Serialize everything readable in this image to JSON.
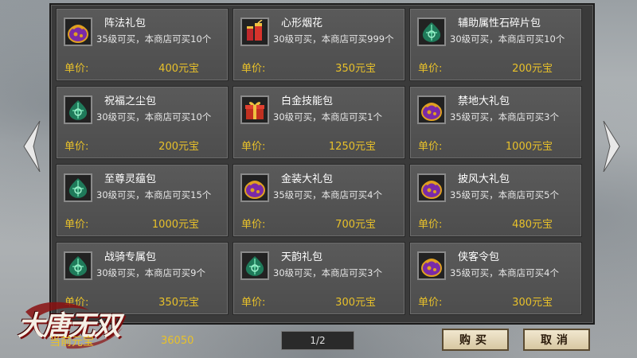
{
  "game": {
    "logo_text": "大唐无双"
  },
  "shop": {
    "price_label": "单价:",
    "items": [
      {
        "name": "阵法礼包",
        "desc": "35级可买，本商店可买10个",
        "price": "400元宝",
        "icon": "purple-gift-bag-icon"
      },
      {
        "name": "心形烟花",
        "desc": "30级可买，本商店可买999个",
        "price": "350元宝",
        "icon": "firework-icon"
      },
      {
        "name": "辅助属性石碎片包",
        "desc": "30级可买，本商店可买10个",
        "price": "200元宝",
        "icon": "green-bag-icon"
      },
      {
        "name": "祝福之尘包",
        "desc": "30级可买，本商店可买10个",
        "price": "200元宝",
        "icon": "green-bag-icon"
      },
      {
        "name": "白金技能包",
        "desc": "30级可买，本商店可买1个",
        "price": "1250元宝",
        "icon": "gift-box-icon"
      },
      {
        "name": "禁地大礼包",
        "desc": "35级可买，本商店可买3个",
        "price": "1000元宝",
        "icon": "purple-gift-bag-icon"
      },
      {
        "name": "至尊灵蕴包",
        "desc": "30级可买，本商店可买15个",
        "price": "1000元宝",
        "icon": "green-bag-icon"
      },
      {
        "name": "金装大礼包",
        "desc": "35级可买，本商店可买4个",
        "price": "700元宝",
        "icon": "purple-gift-bag-icon"
      },
      {
        "name": "披风大礼包",
        "desc": "35级可买，本商店可买5个",
        "price": "480元宝",
        "icon": "purple-gift-bag-icon"
      },
      {
        "name": "战骑专属包",
        "desc": "30级可买，本商店可买9个",
        "price": "350元宝",
        "icon": "green-bag-icon"
      },
      {
        "name": "天韵礼包",
        "desc": "30级可买，本商店可买3个",
        "price": "300元宝",
        "icon": "green-bag-icon"
      },
      {
        "name": "侠客令包",
        "desc": "35级可买，本商店可买4个",
        "price": "300元宝",
        "icon": "purple-gift-bag-icon"
      }
    ]
  },
  "footer": {
    "currency_label": "当前元宝",
    "currency_value": "36050",
    "page_indicator": "1/2",
    "buy_label": "购买",
    "cancel_label": "取消"
  },
  "colors": {
    "gold_text": "#e8c12a",
    "panel": "#3a3a3a",
    "card": "#555555"
  }
}
